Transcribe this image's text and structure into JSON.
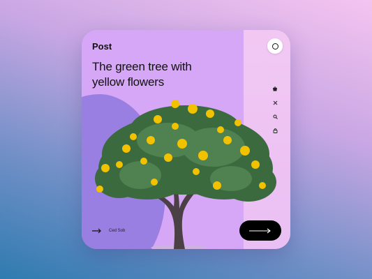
{
  "card": {
    "brand": "Post",
    "headline": "The green tree with yellow flowers",
    "nav_label": "Ced Sob"
  },
  "icons": {
    "top_right": "circle-icon",
    "side": [
      "bag-icon",
      "close-icon",
      "search-icon",
      "lock-icon"
    ],
    "bottom_left": "arrow-right-icon",
    "cta": "arrow-right-icon"
  },
  "colors": {
    "card_purple": "#d6a6f7",
    "panel_pink": "#f2c8f3",
    "blob_violet": "#9a7fe3",
    "button_black": "#000000"
  }
}
